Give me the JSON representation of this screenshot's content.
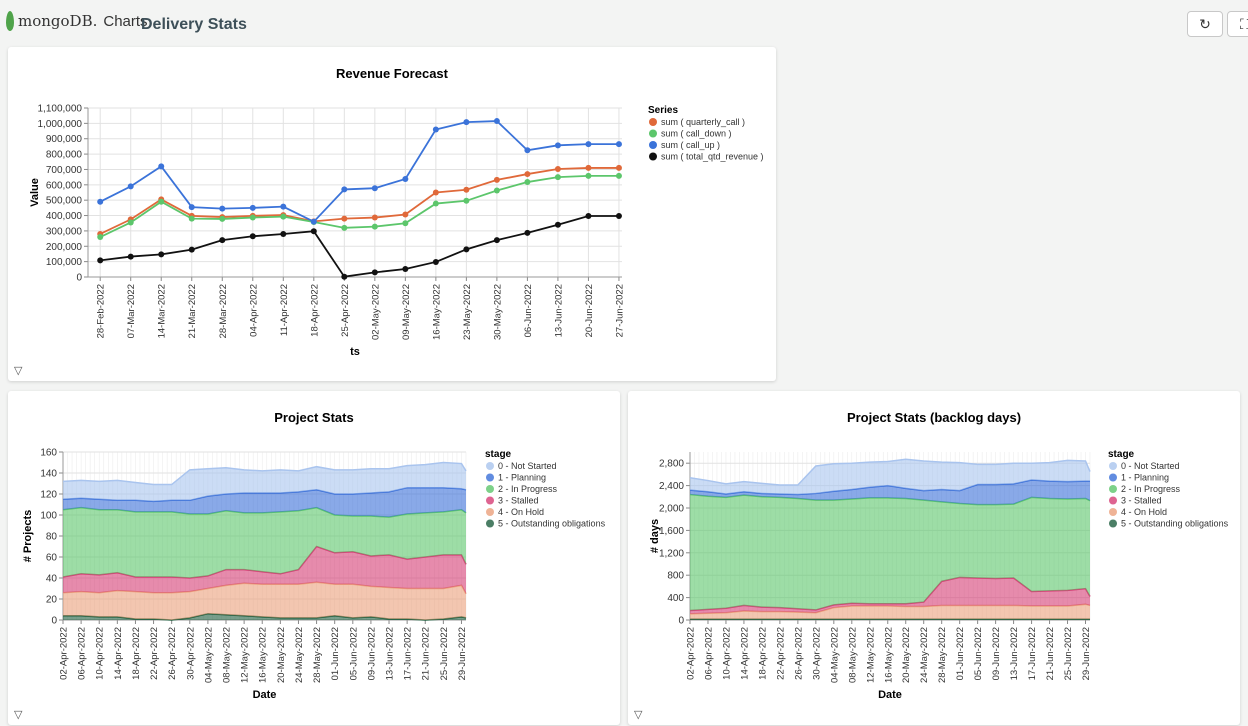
{
  "header": {
    "logo_text": "mongoDB.",
    "product": "Charts",
    "title": "Delivery Stats",
    "refresh_icon": "refresh-icon",
    "fullscreen_icon": "fullscreen-icon"
  },
  "filter_icon": "filter-icon",
  "chart_data": [
    {
      "type": "line",
      "title": "Revenue Forecast",
      "xlabel": "ts",
      "ylabel": "Value",
      "ylim": [
        0,
        1100000
      ],
      "yticks": [
        0,
        100000,
        200000,
        300000,
        400000,
        500000,
        600000,
        700000,
        800000,
        900000,
        1000000,
        1100000
      ],
      "ytick_labels": [
        "0",
        "100,000",
        "200,000",
        "300,000",
        "400,000",
        "500,000",
        "600,000",
        "700,000",
        "800,000",
        "900,000",
        "1,000,000",
        "1,100,000"
      ],
      "categories": [
        "28-Feb-2022",
        "07-Mar-2022",
        "14-Mar-2022",
        "21-Mar-2022",
        "28-Mar-2022",
        "04-Apr-2022",
        "11-Apr-2022",
        "18-Apr-2022",
        "25-Apr-2022",
        "02-May-2022",
        "09-May-2022",
        "16-May-2022",
        "23-May-2022",
        "30-May-2022",
        "06-Jun-2022",
        "13-Jun-2022",
        "20-Jun-2022",
        "27-Jun-2022"
      ],
      "legend_title": "Series",
      "legend_position": "right",
      "grid": true,
      "series": [
        {
          "name": "sum ( quarterly_call )",
          "color": "#e0693a",
          "values": [
            280000,
            375000,
            505000,
            398000,
            390000,
            398000,
            403000,
            362000,
            380000,
            387000,
            407000,
            550000,
            568000,
            632000,
            670000,
            703000,
            710000,
            710000
          ]
        },
        {
          "name": "sum ( call_down )",
          "color": "#5cc66b",
          "values": [
            260000,
            355000,
            490000,
            380000,
            378000,
            387000,
            393000,
            358000,
            320000,
            328000,
            350000,
            478000,
            496000,
            563000,
            618000,
            650000,
            658000,
            658000
          ]
        },
        {
          "name": "sum ( call_up )",
          "color": "#3b73d9",
          "values": [
            490000,
            590000,
            720000,
            455000,
            445000,
            450000,
            458000,
            360000,
            570000,
            578000,
            638000,
            960000,
            1008000,
            1015000,
            825000,
            857000,
            865000,
            865000
          ]
        },
        {
          "name": "sum ( total_qtd_revenue )",
          "color": "#111111",
          "values": [
            108000,
            133000,
            147000,
            178000,
            240000,
            265000,
            280000,
            298000,
            2000,
            30000,
            52000,
            98000,
            180000,
            240000,
            287000,
            340000,
            397000,
            397000
          ]
        }
      ]
    },
    {
      "type": "area",
      "stacked": true,
      "title": "Project Stats",
      "xlabel": "Date",
      "ylabel": "# Projects",
      "ylim": [
        0,
        160
      ],
      "yticks": [
        0,
        20,
        40,
        60,
        80,
        100,
        120,
        140,
        160
      ],
      "ytick_labels": [
        "0",
        "20",
        "40",
        "60",
        "80",
        "100",
        "120",
        "140",
        "160"
      ],
      "xlim": [
        "02-Apr-2022",
        "30-Jun-2022"
      ],
      "x": [
        "02-Apr-2022",
        "06-Apr-2022",
        "10-Apr-2022",
        "14-Apr-2022",
        "18-Apr-2022",
        "22-Apr-2022",
        "26-Apr-2022",
        "30-Apr-2022",
        "04-May-2022",
        "08-May-2022",
        "12-May-2022",
        "16-May-2022",
        "20-May-2022",
        "24-May-2022",
        "28-May-2022",
        "01-Jun-2022",
        "05-Jun-2022",
        "09-Jun-2022",
        "13-Jun-2022",
        "17-Jun-2022",
        "21-Jun-2022",
        "25-Jun-2022",
        "29-Jun-2022",
        "30-Jun-2022"
      ],
      "xtick_labels": [
        "02-Apr-2022",
        "06-Apr-2022",
        "10-Apr-2022",
        "14-Apr-2022",
        "18-Apr-2022",
        "22-Apr-2022",
        "26-Apr-2022",
        "30-Apr-2022",
        "04-May-2022",
        "08-May-2022",
        "12-May-2022",
        "16-May-2022",
        "20-May-2022",
        "24-May-2022",
        "28-May-2022",
        "01-Jun-2022",
        "05-Jun-2022",
        "09-Jun-2022",
        "13-Jun-2022",
        "17-Jun-2022",
        "21-Jun-2022",
        "25-Jun-2022",
        "29-Jun-2022"
      ],
      "legend_title": "stage",
      "legend_position": "right",
      "grid": true,
      "series": [
        {
          "name": "5 - Outstanding obligations",
          "color": "#1e5e3e",
          "values": [
            4,
            4,
            3,
            3,
            1,
            1,
            0,
            2,
            6,
            5,
            4,
            3,
            2,
            2,
            2,
            4,
            2,
            3,
            1,
            1,
            0,
            1,
            3,
            2
          ]
        },
        {
          "name": "4 - On Hold",
          "color": "#eba07c",
          "values": [
            22,
            23,
            23,
            25,
            26,
            25,
            26,
            25,
            24,
            28,
            31,
            31,
            32,
            32,
            34,
            30,
            32,
            29,
            30,
            29,
            30,
            29,
            30,
            23
          ]
        },
        {
          "name": "3 - Stalled",
          "color": "#d63d75",
          "values": [
            15,
            17,
            17,
            17,
            14,
            15,
            15,
            13,
            12,
            15,
            13,
            12,
            10,
            14,
            34,
            30,
            31,
            29,
            31,
            28,
            30,
            32,
            29,
            28
          ]
        },
        {
          "name": "2 - In Progress",
          "color": "#5cc66b",
          "values": [
            64,
            63,
            62,
            60,
            62,
            62,
            62,
            61,
            59,
            56,
            54,
            56,
            59,
            56,
            37,
            36,
            34,
            38,
            36,
            43,
            42,
            41,
            43,
            49
          ]
        },
        {
          "name": "1 - Planning",
          "color": "#3a6fd8",
          "values": [
            10,
            9,
            10,
            9,
            11,
            10,
            11,
            13,
            17,
            16,
            19,
            19,
            18,
            18,
            17,
            20,
            21,
            22,
            24,
            25,
            24,
            23,
            20,
            22
          ]
        },
        {
          "name": "0 - Not Started",
          "color": "#a9c4ee",
          "values": [
            17,
            17,
            17,
            19,
            17,
            16,
            15,
            29,
            26,
            25,
            22,
            21,
            22,
            20,
            22,
            23,
            23,
            23,
            22,
            21,
            22,
            24,
            24,
            18
          ]
        }
      ]
    },
    {
      "type": "area",
      "stacked": true,
      "title": "Project Stats (backlog days)",
      "xlabel": "Date",
      "ylabel": "# days",
      "ylim": [
        0,
        3000
      ],
      "yticks": [
        0,
        400,
        800,
        1200,
        1600,
        2000,
        2400,
        2800
      ],
      "ytick_labels": [
        "0",
        "400",
        "800",
        "1,200",
        "1,600",
        "2,000",
        "2,400",
        "2,800"
      ],
      "xlim": [
        "02-Apr-2022",
        "30-Jun-2022"
      ],
      "x": [
        "02-Apr-2022",
        "06-Apr-2022",
        "10-Apr-2022",
        "14-Apr-2022",
        "18-Apr-2022",
        "22-Apr-2022",
        "26-Apr-2022",
        "30-Apr-2022",
        "04-May-2022",
        "08-May-2022",
        "12-May-2022",
        "16-May-2022",
        "20-May-2022",
        "24-May-2022",
        "28-May-2022",
        "01-Jun-2022",
        "05-Jun-2022",
        "09-Jun-2022",
        "13-Jun-2022",
        "17-Jun-2022",
        "21-Jun-2022",
        "25-Jun-2022",
        "29-Jun-2022",
        "30-Jun-2022"
      ],
      "xtick_labels": [
        "02-Apr-2022",
        "06-Apr-2022",
        "10-Apr-2022",
        "14-Apr-2022",
        "18-Apr-2022",
        "22-Apr-2022",
        "26-Apr-2022",
        "30-Apr-2022",
        "04-May-2022",
        "08-May-2022",
        "12-May-2022",
        "16-May-2022",
        "20-May-2022",
        "24-May-2022",
        "28-May-2022",
        "01-Jun-2022",
        "05-Jun-2022",
        "09-Jun-2022",
        "13-Jun-2022",
        "17-Jun-2022",
        "21-Jun-2022",
        "25-Jun-2022",
        "29-Jun-2022"
      ],
      "legend_title": "stage",
      "legend_position": "right",
      "grid": true,
      "series": [
        {
          "name": "5 - Outstanding obligations",
          "color": "#1e5e3e",
          "values": [
            15,
            15,
            15,
            15,
            15,
            15,
            15,
            15,
            15,
            15,
            15,
            15,
            15,
            15,
            15,
            15,
            15,
            15,
            15,
            15,
            15,
            15,
            15,
            15
          ]
        },
        {
          "name": "4 - On Hold",
          "color": "#eba07c",
          "values": [
            95,
            105,
            115,
            145,
            135,
            135,
            125,
            115,
            205,
            235,
            235,
            235,
            225,
            225,
            245,
            245,
            245,
            245,
            245,
            235,
            235,
            235,
            265,
            245
          ]
        },
        {
          "name": "3 - Stalled",
          "color": "#d63d75",
          "values": [
            60,
            70,
            80,
            100,
            80,
            70,
            60,
            50,
            50,
            50,
            40,
            40,
            50,
            80,
            430,
            500,
            490,
            480,
            490,
            260,
            270,
            280,
            280,
            160
          ]
        },
        {
          "name": "2 - In Progress",
          "color": "#5cc66b",
          "values": [
            2070,
            2020,
            1980,
            1970,
            1970,
            1970,
            1970,
            1960,
            1870,
            1860,
            1890,
            1890,
            1880,
            1820,
            1420,
            1320,
            1310,
            1320,
            1320,
            1680,
            1650,
            1630,
            1610,
            1710
          ]
        },
        {
          "name": "1 - Planning",
          "color": "#3a6fd8",
          "values": [
            80,
            80,
            60,
            60,
            60,
            60,
            70,
            120,
            160,
            170,
            190,
            220,
            180,
            170,
            220,
            230,
            360,
            360,
            360,
            310,
            310,
            310,
            310,
            350
          ]
        },
        {
          "name": "0 - Not Started",
          "color": "#a9c4ee",
          "values": [
            220,
            200,
            180,
            180,
            180,
            160,
            170,
            490,
            490,
            470,
            450,
            430,
            520,
            530,
            490,
            500,
            360,
            360,
            370,
            300,
            330,
            380,
            360,
            170
          ]
        }
      ]
    }
  ]
}
